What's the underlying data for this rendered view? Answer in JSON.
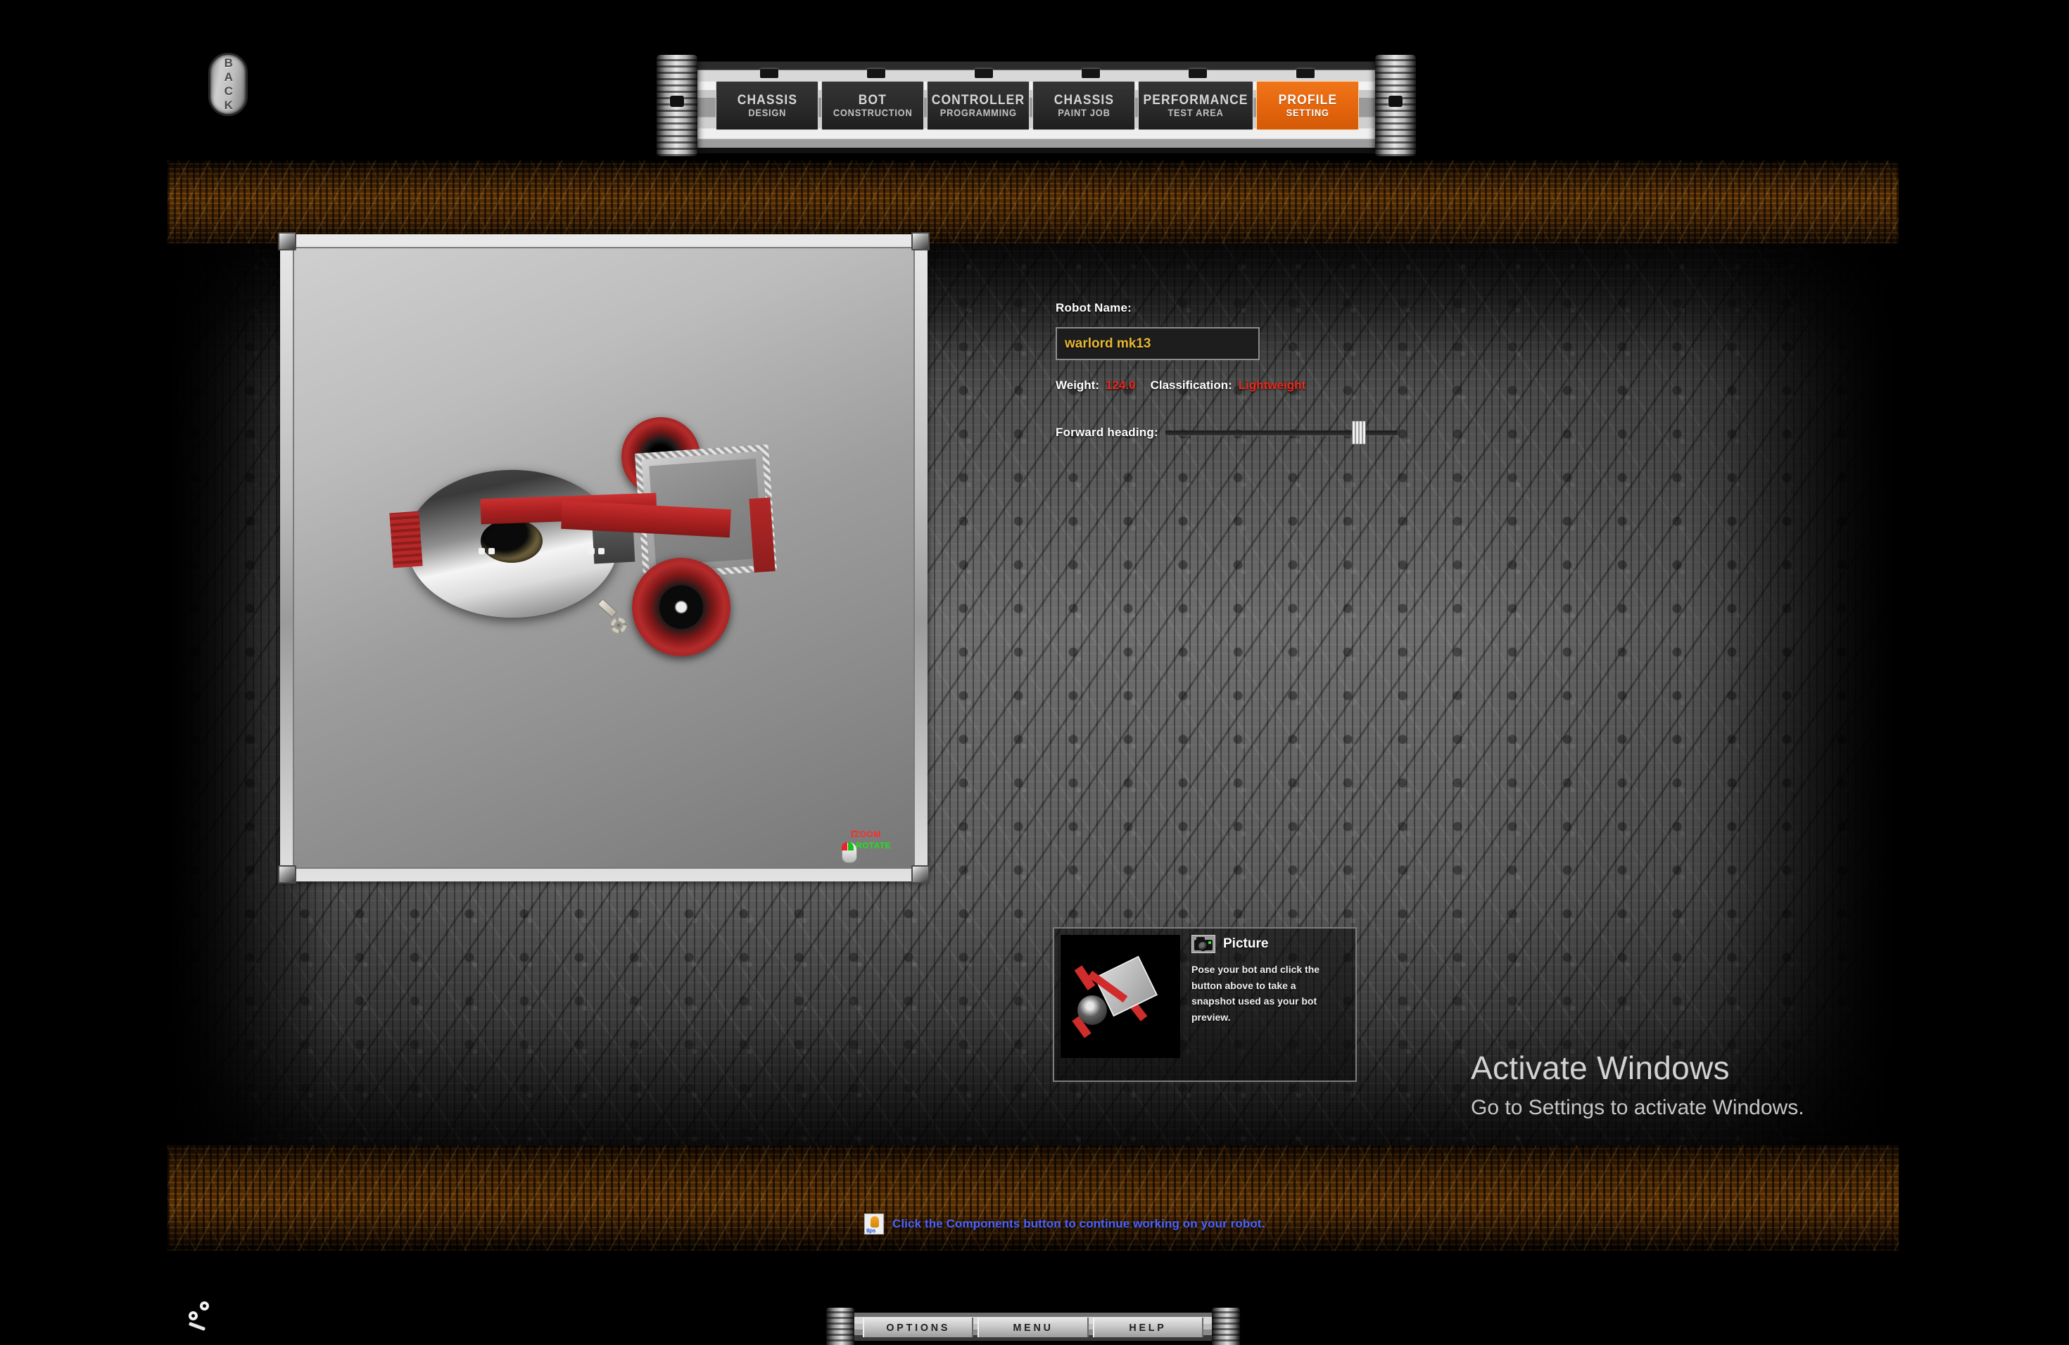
{
  "back_button": {
    "label": "BACK"
  },
  "nav": {
    "tabs": [
      {
        "line1": "CHASSIS",
        "line2": "DESIGN",
        "active": false,
        "name": "tab-chassis-design"
      },
      {
        "line1": "BOT",
        "line2": "CONSTRUCTION",
        "active": false,
        "name": "tab-bot-construction"
      },
      {
        "line1": "CONTROLLER",
        "line2": "PROGRAMMING",
        "active": false,
        "name": "tab-controller-programming"
      },
      {
        "line1": "CHASSIS",
        "line2": "PAINT JOB",
        "active": false,
        "name": "tab-chassis-paint-job"
      },
      {
        "line1": "PERFORMANCE",
        "line2": "TEST AREA",
        "active": false,
        "name": "tab-performance-test-area"
      },
      {
        "line1": "PROFILE",
        "line2": "SETTING",
        "active": true,
        "name": "tab-profile-setting"
      }
    ],
    "active_color": "#ef741a"
  },
  "viewport": {
    "hint_zoom": "ZOOM",
    "hint_rotate": "ROTATE",
    "hint_zoom_color": "#ff2b2b",
    "hint_rotate_color": "#21e021"
  },
  "form": {
    "robot_name_label": "Robot Name:",
    "robot_name_value": "warlord mk13",
    "robot_name_color": "#e8b732",
    "weight_label": "Weight:",
    "weight_value": "124.0",
    "classification_label": "Classification:",
    "classification_value": "Lightweight",
    "stat_value_color": "#ee2a1c",
    "forward_heading_label": "Forward heading:"
  },
  "picture_panel": {
    "title": "Picture",
    "description": "Pose your bot and click the button above to take a snapshot used as your bot preview."
  },
  "watermark": {
    "line1": "Activate Windows",
    "line2": "Go to Settings to activate Windows."
  },
  "tips": {
    "icon_label": "tips",
    "text": "Click the Components button to continue working on your robot.",
    "text_color": "#4a63ff"
  },
  "bottom_bar": {
    "items": [
      {
        "label": "OPTIONS",
        "name": "bottom-button-options"
      },
      {
        "label": "MENU",
        "name": "bottom-button-menu"
      },
      {
        "label": "HELP",
        "name": "bottom-button-help"
      }
    ]
  }
}
